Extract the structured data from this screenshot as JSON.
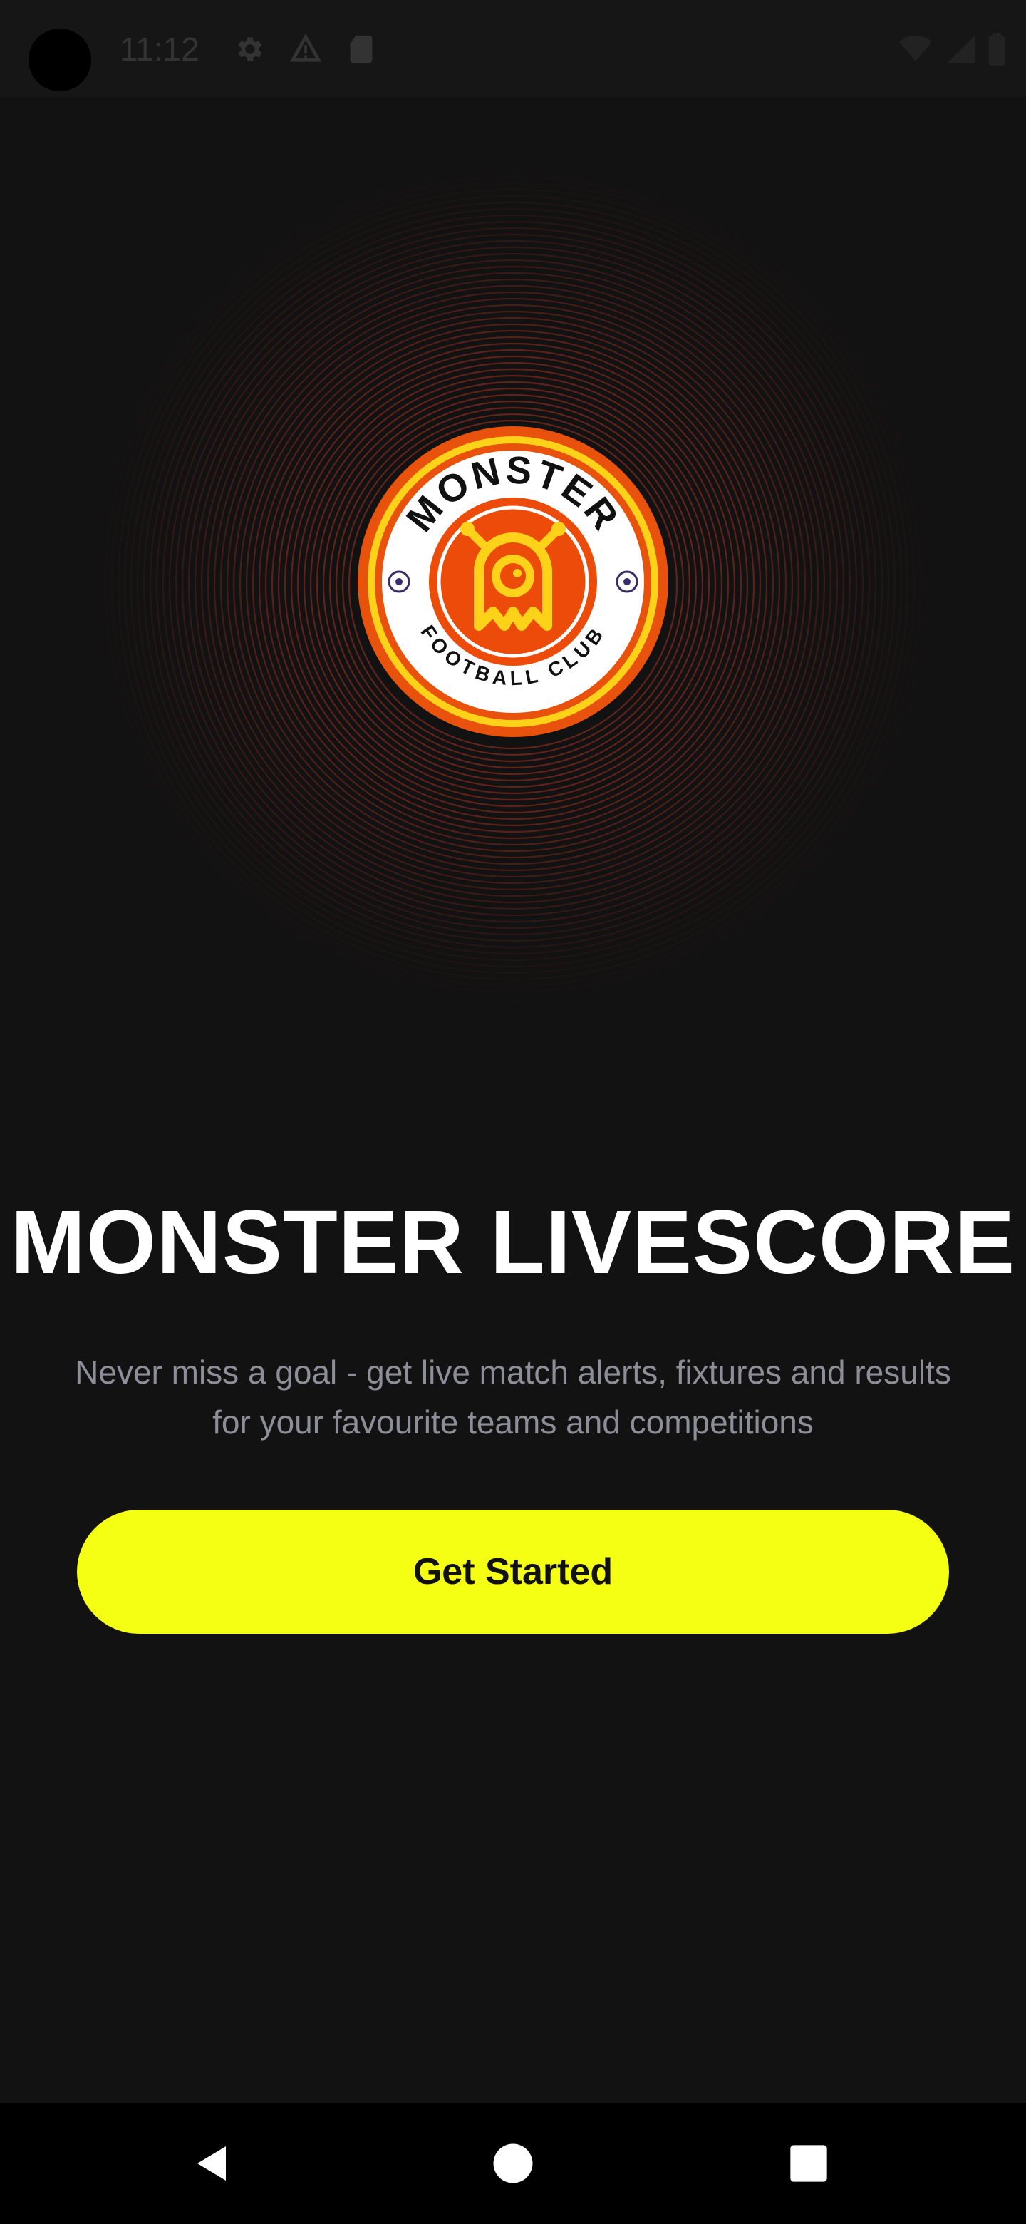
{
  "status_bar": {
    "time": "11:12",
    "icons": [
      "gear-icon",
      "alert-triangle-icon",
      "sd-card-icon",
      "wifi-icon",
      "signal-icon",
      "battery-icon"
    ]
  },
  "logo": {
    "top_text": "MONSTER",
    "bottom_text": "FOOTBALL CLUB",
    "colors": {
      "ring": "#e8520c",
      "inner_ring": "#ffd21a",
      "white": "#ffffff",
      "center": "#ec4b0a",
      "mascot": "#ffd21a",
      "rings_accent": "#e8402a"
    }
  },
  "main": {
    "title": "MONSTER LIVESCORE",
    "subtitle": "Never miss a goal - get live match alerts, fixtures and results for your favourite teams and competitions",
    "cta_label": "Get Started",
    "cta_color": "#f5ff14"
  },
  "nav_bar": {
    "buttons": [
      "back-icon",
      "home-icon",
      "recents-icon"
    ]
  }
}
